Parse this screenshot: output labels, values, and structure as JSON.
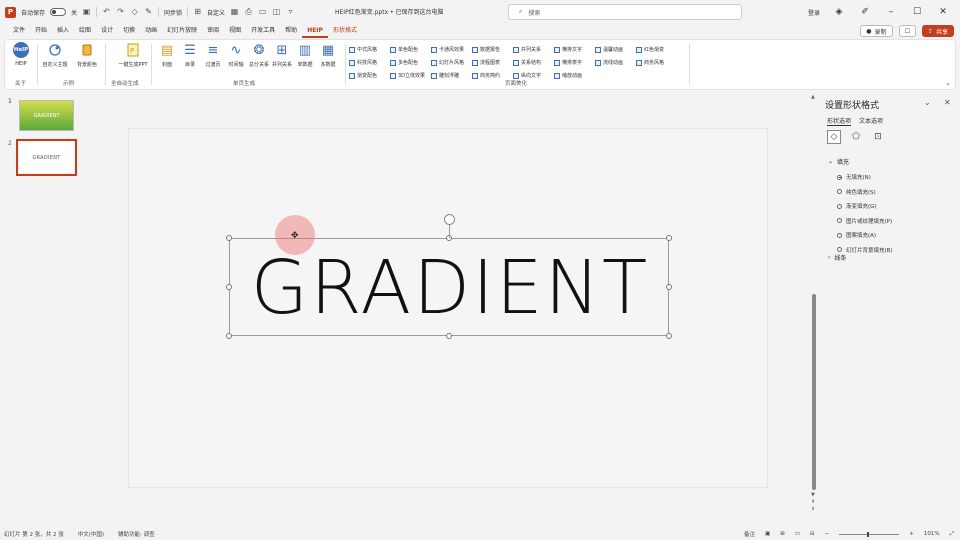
{
  "titlebar": {
    "autosave_label": "自动保存",
    "autosave_state": "关",
    "sync_label": "同步锁",
    "doc_title": "HEIP红色渐变.pptx • 已保存到这台电脑",
    "search_placeholder": "搜索",
    "user_label": "登录",
    "extra_label": "自定义"
  },
  "tabs": {
    "items": [
      "文件",
      "开始",
      "插入",
      "绘图",
      "设计",
      "切换",
      "动画",
      "幻灯片放映",
      "审阅",
      "视图",
      "开发工具",
      "帮助",
      "HEIP",
      "形状格式"
    ],
    "active": "HEIP",
    "record_label": "录制",
    "share_label": "共享"
  },
  "ribbon": {
    "groups": [
      {
        "label": "关于",
        "buttons": [
          "HEIP"
        ]
      },
      {
        "label": "示例",
        "buttons": [
          "自定义主题",
          "背景颜色"
        ]
      },
      {
        "label": "全自动生成",
        "buttons": [
          "一键生成PPT"
        ]
      },
      {
        "label": "单页生成",
        "buttons": [
          "封面",
          "目录",
          "过渡页",
          "时间轴",
          "总分关系",
          "并列关系",
          "单数据",
          "多数据"
        ]
      },
      {
        "label": "页面美化",
        "buttons": []
      }
    ],
    "checks": [
      "中式风格",
      "单色配色",
      "卡通风效果",
      "数据报告",
      "并列关系",
      "横排文字",
      "温馨动画",
      "红色渐变",
      "科技风格",
      "多色配色",
      "幻灯片风格",
      "流程图表",
      "关系结构",
      "横排表字",
      "流线动画",
      "商务风格",
      "渐变配色",
      "3D立体效果",
      "雕刻浮雕",
      "商务简约",
      "纵向文字",
      "缩放动画"
    ]
  },
  "slides": [
    {
      "number": "1",
      "text": "GRADIENT"
    },
    {
      "number": "2",
      "text": "GRADIENT"
    }
  ],
  "canvas": {
    "main_text": "GRADIENT"
  },
  "pane": {
    "title": "设置形状格式",
    "tabs": [
      "形状选项",
      "文本选项"
    ],
    "fill_section": "填充",
    "line_section": "线条",
    "fill_options": [
      "无填充(N)",
      "纯色填充(S)",
      "渐变填充(G)",
      "图片或纹理填充(P)",
      "图案填充(A)",
      "幻灯片背景填充(B)"
    ],
    "selected_fill": "无填充(N)"
  },
  "status": {
    "slide_info": "幻灯片 第 2 张，共 2 张",
    "language": "中文(中国)",
    "accessibility": "辅助功能: 调查",
    "notes": "备注",
    "zoom": "101%"
  },
  "colors": {
    "accent": "#c43e1c",
    "help_blue": "#3d6fb6"
  }
}
